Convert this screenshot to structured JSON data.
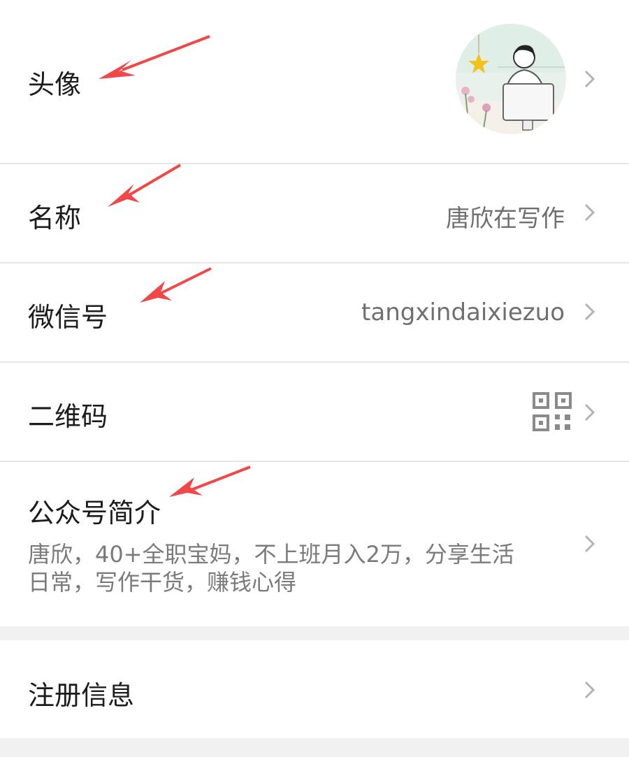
{
  "rows": {
    "avatar": {
      "label": "头像"
    },
    "name": {
      "label": "名称",
      "value": "唐欣在写作"
    },
    "wechat_id": {
      "label": "微信号",
      "value": "tangxindaixiezuo"
    },
    "qrcode": {
      "label": "二维码"
    },
    "intro": {
      "label": "公众号简介",
      "text_line1": "唐欣，40+全职宝妈，不上班月入2万，分享生活",
      "text_line2": "日常，写作干货，赚钱心得"
    },
    "registration": {
      "label": "注册信息"
    }
  },
  "icons": {
    "chevron": "chevron-right-icon",
    "qrcode": "qrcode-icon",
    "annotation_arrow": "red-arrow-icon"
  },
  "colors": {
    "arrow": "#f04848",
    "divider": "#e6e6e6",
    "section_gap": "#f1f1f1"
  }
}
